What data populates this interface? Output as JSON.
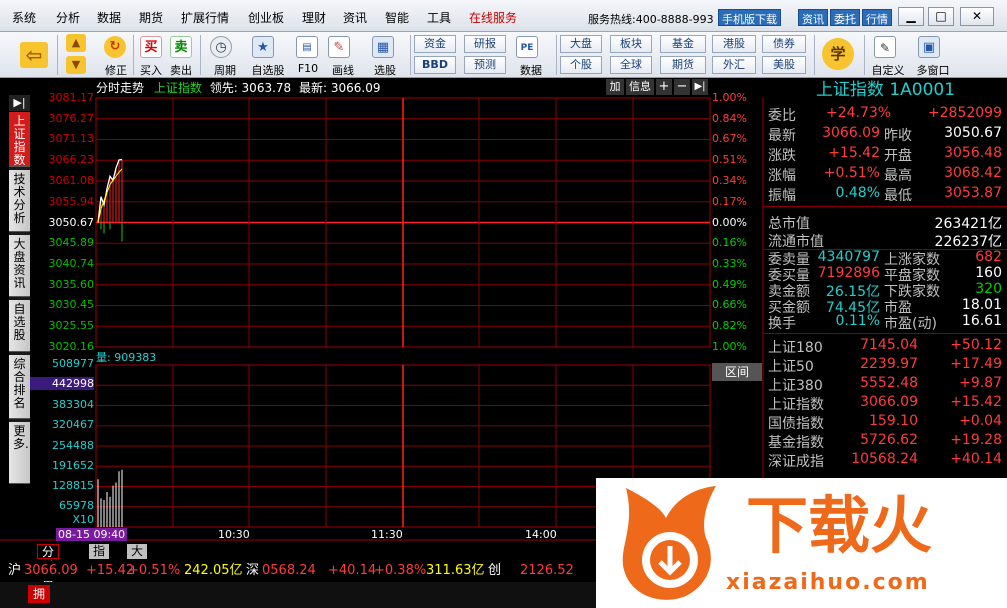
{
  "menu": {
    "items": [
      "系统",
      "分析",
      "数据",
      "期货",
      "扩展行情",
      "创业板",
      "理财",
      "资讯",
      "智能",
      "工具",
      "在线服务"
    ],
    "hotline": "服务热线:400-8888-993",
    "mobile_btn": "手机版下载",
    "news_btn": "资讯",
    "trust_btn": "委托",
    "quote_btn": "行情"
  },
  "toolbar": {
    "buy": "买入",
    "sell": "卖出",
    "fix": "修正",
    "period": "周期",
    "watch": "自选股",
    "f10": "F10",
    "draw": "画线",
    "pick": "选股",
    "funds": "资金",
    "bbd": "BBD",
    "research": "研报",
    "forecast": "预测",
    "pe": "PE",
    "data": "数据",
    "market": "大盘",
    "stock": "个股",
    "sector": "板块",
    "global": "全球",
    "fund": "基金",
    "futures": "期货",
    "hk": "港股",
    "fx": "外汇",
    "bond": "债券",
    "us": "美股",
    "learn": "学",
    "custom": "自定义",
    "multiwin": "多窗口"
  },
  "leftnav": [
    "上证指数",
    "技术分析",
    "大盘资讯",
    "自选股",
    "综合排名",
    "更多..."
  ],
  "chart_head": {
    "mode": "分时走势",
    "index": "上证指数",
    "lead": "领先: 3063.78",
    "latest": "最新: 3066.09",
    "btn_add": "加",
    "btn_info": "信息"
  },
  "chart_data": {
    "type": "line",
    "price_ticks_up": [
      "3081.17",
      "3076.27",
      "3071.13",
      "3066.23",
      "3061.08",
      "3055.94"
    ],
    "price_base": "3050.67",
    "price_ticks_down": [
      "3045.89",
      "3040.74",
      "3035.60",
      "3030.45",
      "3025.55",
      "3020.16"
    ],
    "pct_ticks_up": [
      "1.00%",
      "0.84%",
      "0.67%",
      "0.51%",
      "0.34%",
      "0.17%"
    ],
    "pct_base": "0.00%",
    "pct_ticks_down": [
      "0.16%",
      "0.33%",
      "0.49%",
      "0.66%",
      "0.82%",
      "1.00%"
    ],
    "volume_label": "量: 909383",
    "volume_ticks": [
      "508977",
      "442998",
      "383304",
      "320467",
      "254488",
      "191652",
      "128815",
      "65978"
    ],
    "volume_unit": "X10",
    "time_ticks": [
      "10:30",
      "11:30",
      "14:00"
    ],
    "date_time": "08-15 09:40",
    "interval_btn": "区间",
    "price_series": [
      3050.67,
      3057,
      3055,
      3059,
      3062,
      3061,
      3064,
      3066,
      3066.09
    ],
    "avg_series": [
      3050.67,
      3054,
      3056,
      3058,
      3060,
      3061,
      3062,
      3063,
      3063.78
    ],
    "volume_series": [
      150000,
      90000,
      85000,
      110000,
      95000,
      130000,
      140000,
      175000,
      180000
    ]
  },
  "quote": {
    "title": "上证指数 1A0001",
    "weibi_k": "委比",
    "weibi_v": "+24.73%",
    "weibi_v2": "+2852099",
    "latest_k": "最新",
    "latest_v": "3066.09",
    "prev_k": "昨收",
    "prev_v": "3050.67",
    "chg_k": "涨跌",
    "chg_v": "+15.42",
    "open_k": "开盘",
    "open_v": "3056.48",
    "pct_k": "涨幅",
    "pct_v": "+0.51%",
    "high_k": "最高",
    "high_v": "3068.42",
    "amp_k": "振幅",
    "amp_v": "0.48%",
    "low_k": "最低",
    "low_v": "3053.87",
    "cap_k": "总市值",
    "cap_v": "263421亿",
    "float_k": "流通市值",
    "float_v": "226237亿",
    "wm_k": "委卖量",
    "wm_v": "4340797",
    "up_k": "上涨家数",
    "up_v": "682",
    "wb_k": "委买量",
    "wb_v": "7192896",
    "flat_k": "平盘家数",
    "flat_v": "160",
    "sm_k": "卖金额",
    "sm_v": "26.15亿",
    "down_k": "下跌家数",
    "down_v": "320",
    "bm_k": "买金额",
    "bm_v": "74.45亿",
    "pe_k": "市盈",
    "pe_v": "18.01",
    "to_k": "换手",
    "to_v": "0.11%",
    "ped_k": "市盈(动)",
    "ped_v": "16.61"
  },
  "indices": [
    {
      "name": "上证180",
      "value": "7145.04",
      "chg": "+50.12"
    },
    {
      "name": "上证50",
      "value": "2239.97",
      "chg": "+17.49"
    },
    {
      "name": "上证380",
      "value": "5552.48",
      "chg": "+9.87"
    },
    {
      "name": "上证指数",
      "value": "3066.09",
      "chg": "+15.42"
    },
    {
      "name": "国债指数",
      "value": "159.10",
      "chg": "+0.04"
    },
    {
      "name": "基金指数",
      "value": "5726.62",
      "chg": "+19.28"
    },
    {
      "name": "深证成指",
      "value": "10568.24",
      "chg": "+40.14"
    }
  ],
  "tabs": [
    "分时量",
    "指标",
    "大盘资讯"
  ],
  "ticker": {
    "sh_label": "沪",
    "sh_value": "3066.09",
    "sh_chg": "+15.42",
    "sh_pct": "+0.51%",
    "sh_amt": "242.05亿",
    "sz_label": "深",
    "sz_value": "0568.24",
    "sz_chg": "+40.14",
    "sz_pct": "+0.38%",
    "sz_amt": "311.63亿",
    "cy_label": "创",
    "cy_value": "2126.52"
  },
  "status": {
    "badge": "拥"
  },
  "watermark": {
    "brand": "下载火",
    "url": "xiazaihuo.com"
  }
}
